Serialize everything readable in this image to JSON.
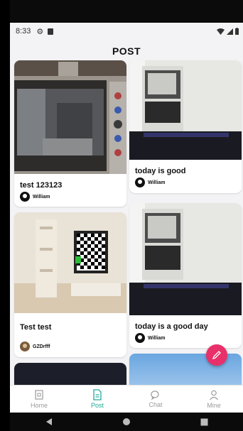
{
  "status": {
    "time": "8:33"
  },
  "header": {
    "title": "POST"
  },
  "posts": [
    {
      "title": "test 123123",
      "author": "William"
    },
    {
      "title": "today is good",
      "author": "William"
    },
    {
      "title": "Test test",
      "author": "GZDrfff"
    },
    {
      "title": "today is a good day",
      "author": "William"
    }
  ],
  "tabs": [
    {
      "label": "Home",
      "icon": "home-icon"
    },
    {
      "label": "Post",
      "icon": "post-icon"
    },
    {
      "label": "Chat",
      "icon": "chat-icon"
    },
    {
      "label": "Mine",
      "icon": "person-icon"
    }
  ],
  "colors": {
    "accent": "#21a99a",
    "fab": "#e8306a"
  }
}
